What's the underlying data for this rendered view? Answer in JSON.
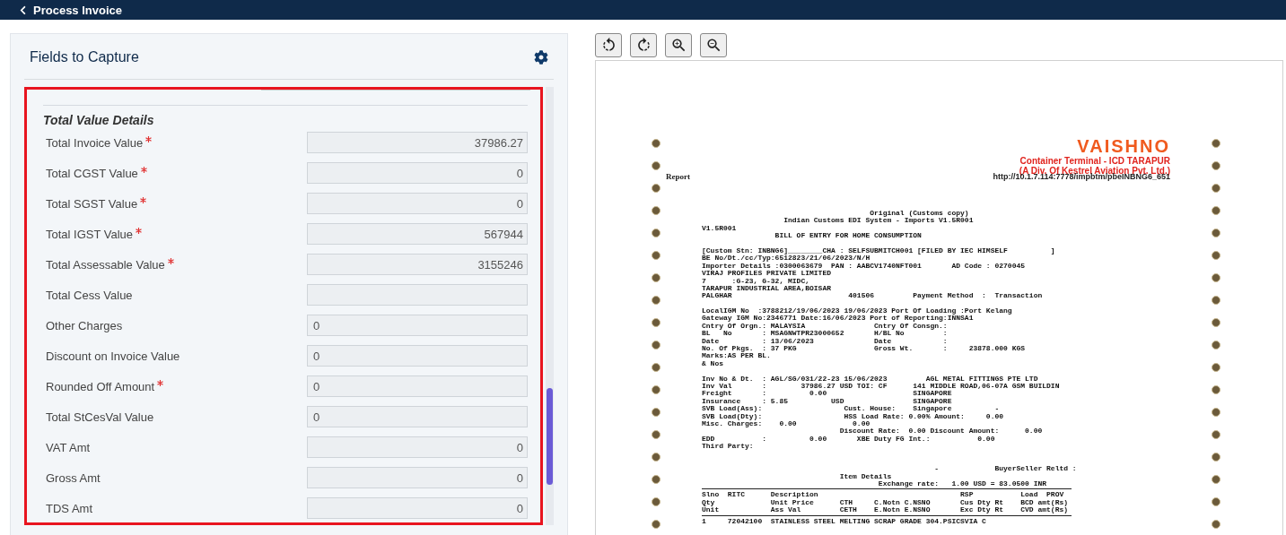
{
  "header": {
    "title": "Process Invoice"
  },
  "panel": {
    "title": "Fields to Capture",
    "section": "Total Value Details",
    "fields": [
      {
        "label": "Total Invoice Value",
        "required": true,
        "value": "37986.27",
        "kind": "numeric"
      },
      {
        "label": "Total CGST Value",
        "required": true,
        "value": "0",
        "kind": "numeric"
      },
      {
        "label": "Total SGST Value",
        "required": true,
        "value": "0",
        "kind": "numeric"
      },
      {
        "label": "Total IGST Value",
        "required": true,
        "value": "567944",
        "kind": "numeric"
      },
      {
        "label": "Total Assessable Value",
        "required": true,
        "value": "3155246",
        "kind": "numeric"
      },
      {
        "label": "Total Cess Value",
        "required": false,
        "kind": "numeric"
      },
      {
        "label": "Other Charges",
        "required": false,
        "value": "0",
        "kind": "text"
      },
      {
        "label": "Discount on Invoice Value",
        "required": false,
        "value": "0",
        "kind": "text"
      },
      {
        "label": "Rounded Off Amount",
        "required": true,
        "value": "0",
        "kind": "text"
      },
      {
        "label": "Total StCesVal Value",
        "required": false,
        "value": "0",
        "kind": "text"
      },
      {
        "label": "VAT Amt",
        "required": false,
        "value": "0",
        "kind": "numeric"
      },
      {
        "label": "Gross Amt",
        "required": false,
        "value": "0",
        "kind": "numeric"
      },
      {
        "label": "TDS Amt",
        "required": false,
        "value": "0",
        "kind": "numeric"
      }
    ]
  },
  "document": {
    "logo": "VAISHNO",
    "terminal": "Container Terminal - ICD TARAPUR",
    "division": "(A Div. Of Kestrel Aviation Pvt. Ltd.)",
    "report": "Report",
    "url": "http://10.1.7.114:7778/impbtm/pbeINBNG6_651",
    "lines": [
      {
        "kind": "line",
        "text": "                                       Original (Customs copy)"
      },
      {
        "kind": "line",
        "text": "                   Indian Customs EDI System - Imports V1.5R001"
      },
      {
        "kind": "line",
        "text": "V1.5R001"
      },
      {
        "kind": "line",
        "text": "                 BILL OF ENTRY FOR HOME CONSUMPTION"
      },
      {
        "kind": "gap"
      },
      {
        "kind": "line",
        "text": "[Custom Stn: INBNG6]________CHA : SELFSUBMITCH001 [FILED BY IEC HIMSELF          ]"
      },
      {
        "kind": "line",
        "text": "BE No/Dt./cc/Typ:6512823/21/06/2023/N/H"
      },
      {
        "kind": "line",
        "text": "Importer Details :0300063679  PAN : AABCV1740NFT001       AD Code : 0270045"
      },
      {
        "kind": "line",
        "text": "VIRAJ PROFILES PRIVATE LIMITED"
      },
      {
        "kind": "line",
        "text": "7      :G-23, G-32, MIDC,"
      },
      {
        "kind": "line",
        "text": "TARAPUR INDUSTRIAL AREA,BOISAR"
      },
      {
        "kind": "line",
        "text": "PALGHAR                           401506         Payment Method  :  Transaction"
      },
      {
        "kind": "gap"
      },
      {
        "kind": "line",
        "text": "LocalIGM No  :3788212/19/06/2023 19/06/2023 Port Of Loading :Port Kelang"
      },
      {
        "kind": "line",
        "text": "Gateway IGM No:2346771 Date:16/06/2023 Port of Reporting:INNSA1"
      },
      {
        "kind": "line",
        "text": "Cntry Of Orgn.: MALAYSIA                Cntry Of Consgn.:"
      },
      {
        "kind": "line",
        "text": "BL   No       : MSAGNWTPR23000652       H/BL No         :"
      },
      {
        "kind": "line",
        "text": "Date          : 13/06/2023              Date            :"
      },
      {
        "kind": "line",
        "text": "No. Of Pkgs.  : 37 PKG                  Gross Wt.       :     23878.000 KGS"
      },
      {
        "kind": "line",
        "text": "Marks:AS PER BL."
      },
      {
        "kind": "line",
        "text": "& Nos"
      },
      {
        "kind": "gap"
      },
      {
        "kind": "line",
        "text": "Inv No & Dt.  : AGL/SG/031/22-23 15/06/2023         AGL METAL FITTINGS PTE LTD"
      },
      {
        "kind": "line",
        "text": "Inv Val       :        37986.27 USD TOI: CF      141 MIDDLE ROAD,06-07A GSM BUILDIN"
      },
      {
        "kind": "line",
        "text": "Freight       :          0.00                    SINGAPORE"
      },
      {
        "kind": "line",
        "text": "Insurance     : 5.85          USD                SINGAPORE"
      },
      {
        "kind": "line",
        "text": "SVB Load(Ass):                   Cust. House:    Singapore          -"
      },
      {
        "kind": "line",
        "text": "SVB Load(Dty):                   HSS Load Rate: 0.00% Amount:     0.00"
      },
      {
        "kind": "line",
        "text": "Misc. Charges:    0.00             0.00"
      },
      {
        "kind": "line",
        "text": "                                Discount Rate:  0.00 Discount Amount:      0.00"
      },
      {
        "kind": "line",
        "text": "EDD           :          0.00       XBE Duty FG Int.:           0.00"
      },
      {
        "kind": "line",
        "text": "Third Party:"
      },
      {
        "kind": "gap"
      },
      {
        "kind": "gap"
      },
      {
        "kind": "line",
        "text": "                                                      -             BuyerSeller Reltd :"
      },
      {
        "kind": "line",
        "text": "                                Item Details"
      },
      {
        "kind": "line",
        "text": "                                         Exchange rate:   1.00 USD = 83.0500 INR"
      },
      {
        "kind": "rule"
      },
      {
        "kind": "line",
        "text": "Slno  RITC      Description                                 RSP           Load  PROV"
      },
      {
        "kind": "line",
        "text": "Qty             Unit Price      CTH     C.Notn C.NSNO       Cus Dty Rt    BCD amt(Rs)"
      },
      {
        "kind": "line",
        "text": "Unit            Ass Val         CETH    E.Notn E.NSNO       Exc Dty Rt    CVD amt(Rs)"
      },
      {
        "kind": "rule"
      },
      {
        "kind": "line",
        "text": "1     72042100  STAINLESS STEEL MELTING SCRAP GRADE 304.PSICSVIA C"
      }
    ]
  }
}
